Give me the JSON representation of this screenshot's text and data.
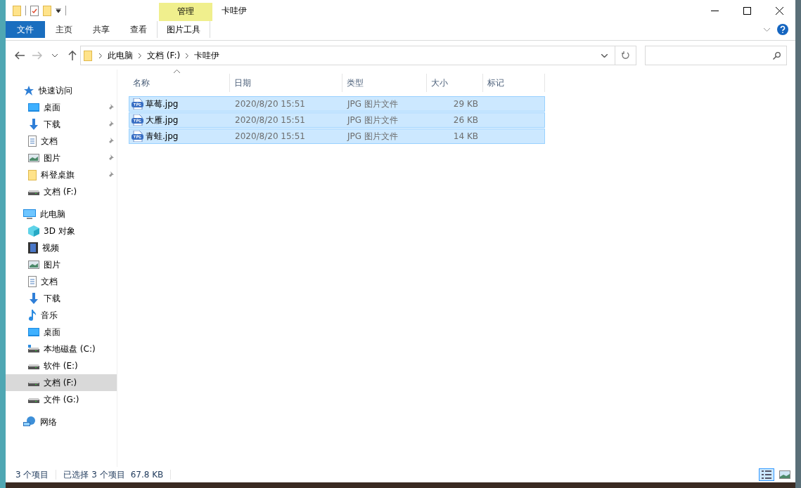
{
  "window": {
    "title": "卡哇伊"
  },
  "ribbon": {
    "tabs": [
      {
        "label": "文件",
        "kind": "file",
        "selected": false
      },
      {
        "label": "主页",
        "kind": "plain",
        "selected": false
      },
      {
        "label": "共享",
        "kind": "plain",
        "selected": false
      },
      {
        "label": "查看",
        "kind": "plain",
        "selected": false
      }
    ],
    "context_group": {
      "label": "管理",
      "tabs": [
        {
          "label": "图片工具"
        }
      ]
    }
  },
  "navigation": [
    {
      "kind": "back",
      "disabled": false
    },
    {
      "kind": "forward",
      "disabled": true
    },
    {
      "kind": "recent",
      "disabled": false
    },
    {
      "kind": "up",
      "disabled": false
    }
  ],
  "address": {
    "crumbs": [
      "此电脑",
      "文档 (F:)",
      "卡哇伊"
    ]
  },
  "sidebar": {
    "items": [
      {
        "label": "快速访问",
        "kind": "star",
        "selected": false,
        "children": [
          {
            "label": "桌面",
            "kind": "desktop",
            "pinned": true,
            "selected": false
          },
          {
            "label": "下载",
            "kind": "download",
            "pinned": true,
            "selected": false
          },
          {
            "label": "文档",
            "kind": "document",
            "pinned": true,
            "selected": false
          },
          {
            "label": "图片",
            "kind": "picture",
            "pinned": true,
            "selected": false
          },
          {
            "label": "科登桌旗",
            "kind": "folder",
            "pinned": true,
            "selected": false
          },
          {
            "label": "文档 (F:)",
            "kind": "drive",
            "pinned": false,
            "selected": false
          }
        ]
      },
      {
        "label": "此电脑",
        "kind": "pc",
        "selected": false,
        "children": [
          {
            "label": "3D 对象",
            "kind": "cube",
            "pinned": false,
            "selected": false
          },
          {
            "label": "视频",
            "kind": "video",
            "pinned": false,
            "selected": false
          },
          {
            "label": "图片",
            "kind": "picture",
            "pinned": false,
            "selected": false
          },
          {
            "label": "文档",
            "kind": "document",
            "pinned": false,
            "selected": false
          },
          {
            "label": "下载",
            "kind": "download",
            "pinned": false,
            "selected": false
          },
          {
            "label": "音乐",
            "kind": "music",
            "pinned": false,
            "selected": false
          },
          {
            "label": "桌面",
            "kind": "desktop",
            "pinned": false,
            "selected": false
          },
          {
            "label": "本地磁盘 (C:)",
            "kind": "system_drive",
            "pinned": false,
            "selected": false
          },
          {
            "label": "软件 (E:)",
            "kind": "drive",
            "pinned": false,
            "selected": false
          },
          {
            "label": "文档 (F:)",
            "kind": "drive",
            "pinned": false,
            "selected": true
          },
          {
            "label": "文件 (G:)",
            "kind": "drive",
            "pinned": false,
            "selected": false
          }
        ]
      },
      {
        "label": "网络",
        "kind": "network",
        "selected": false
      }
    ]
  },
  "table": {
    "columns": [
      {
        "label": "名称",
        "sorted": true
      },
      {
        "label": "日期",
        "sorted": false
      },
      {
        "label": "类型",
        "sorted": false
      },
      {
        "label": "大小",
        "sorted": false
      },
      {
        "label": "标记",
        "sorted": false
      }
    ],
    "rows": [
      {
        "name": "草莓.jpg",
        "date": "2020/8/20 15:51",
        "type": "JPG 图片文件",
        "size": "29 KB",
        "selected": true
      },
      {
        "name": "大雁.jpg",
        "date": "2020/8/20 15:51",
        "type": "JPG 图片文件",
        "size": "26 KB",
        "selected": true
      },
      {
        "name": "青蛙.jpg",
        "date": "2020/8/20 15:51",
        "type": "JPG 图片文件",
        "size": "14 KB",
        "selected": true
      }
    ]
  },
  "status_bar": {
    "count": "3 个项目",
    "selection": "已选择 3 个项目",
    "selection_size": "67.8 KB",
    "views": [
      {
        "kind": "details",
        "selected": true
      },
      {
        "kind": "large_icons",
        "selected": false
      }
    ]
  }
}
